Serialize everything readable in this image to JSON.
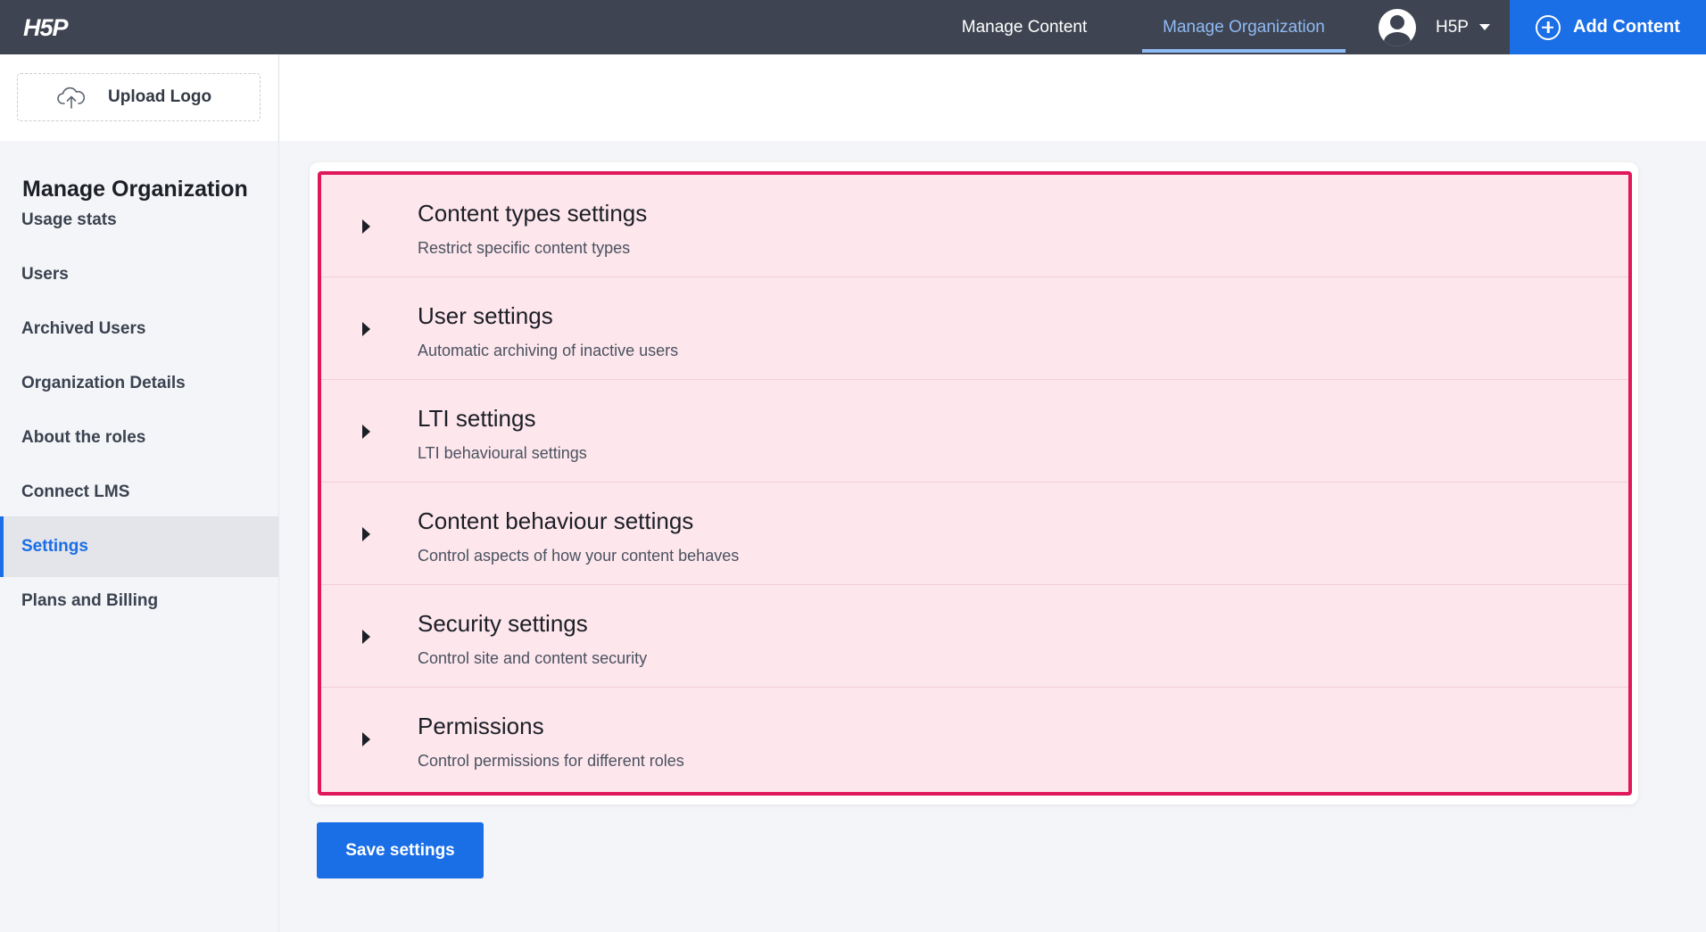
{
  "topbar": {
    "logo_text": "H5P",
    "nav": [
      {
        "label": "Manage Content"
      },
      {
        "label": "Manage Organization",
        "active": true
      }
    ],
    "user": {
      "name": "H5P"
    },
    "add_content_label": "Add Content",
    "colors": {
      "bar": "#3e4451",
      "accent": "#1a6ee6",
      "active_link": "#8fbaf5"
    }
  },
  "logo_area": {
    "upload_label": "Upload Logo",
    "icon": "cloud-upload-icon"
  },
  "sidebar": {
    "title": "Manage Organization",
    "items": [
      {
        "label": "Usage stats"
      },
      {
        "label": "Users"
      },
      {
        "label": "Archived Users"
      },
      {
        "label": "Organization Details"
      },
      {
        "label": "About the roles"
      },
      {
        "label": "Connect LMS"
      },
      {
        "label": "Settings",
        "active": true
      },
      {
        "label": "Plans and Billing"
      }
    ]
  },
  "settings": {
    "highlight_color": "#e0185b",
    "sections": [
      {
        "title": "Content types settings",
        "description": "Restrict specific content types"
      },
      {
        "title": "User settings",
        "description": "Automatic archiving of inactive users"
      },
      {
        "title": "LTI settings",
        "description": "LTI behavioural settings"
      },
      {
        "title": "Content behaviour settings",
        "description": "Control aspects of how your content behaves"
      },
      {
        "title": "Security settings",
        "description": "Control site and content security"
      },
      {
        "title": "Permissions",
        "description": "Control permissions for different roles"
      }
    ],
    "save_label": "Save settings"
  }
}
